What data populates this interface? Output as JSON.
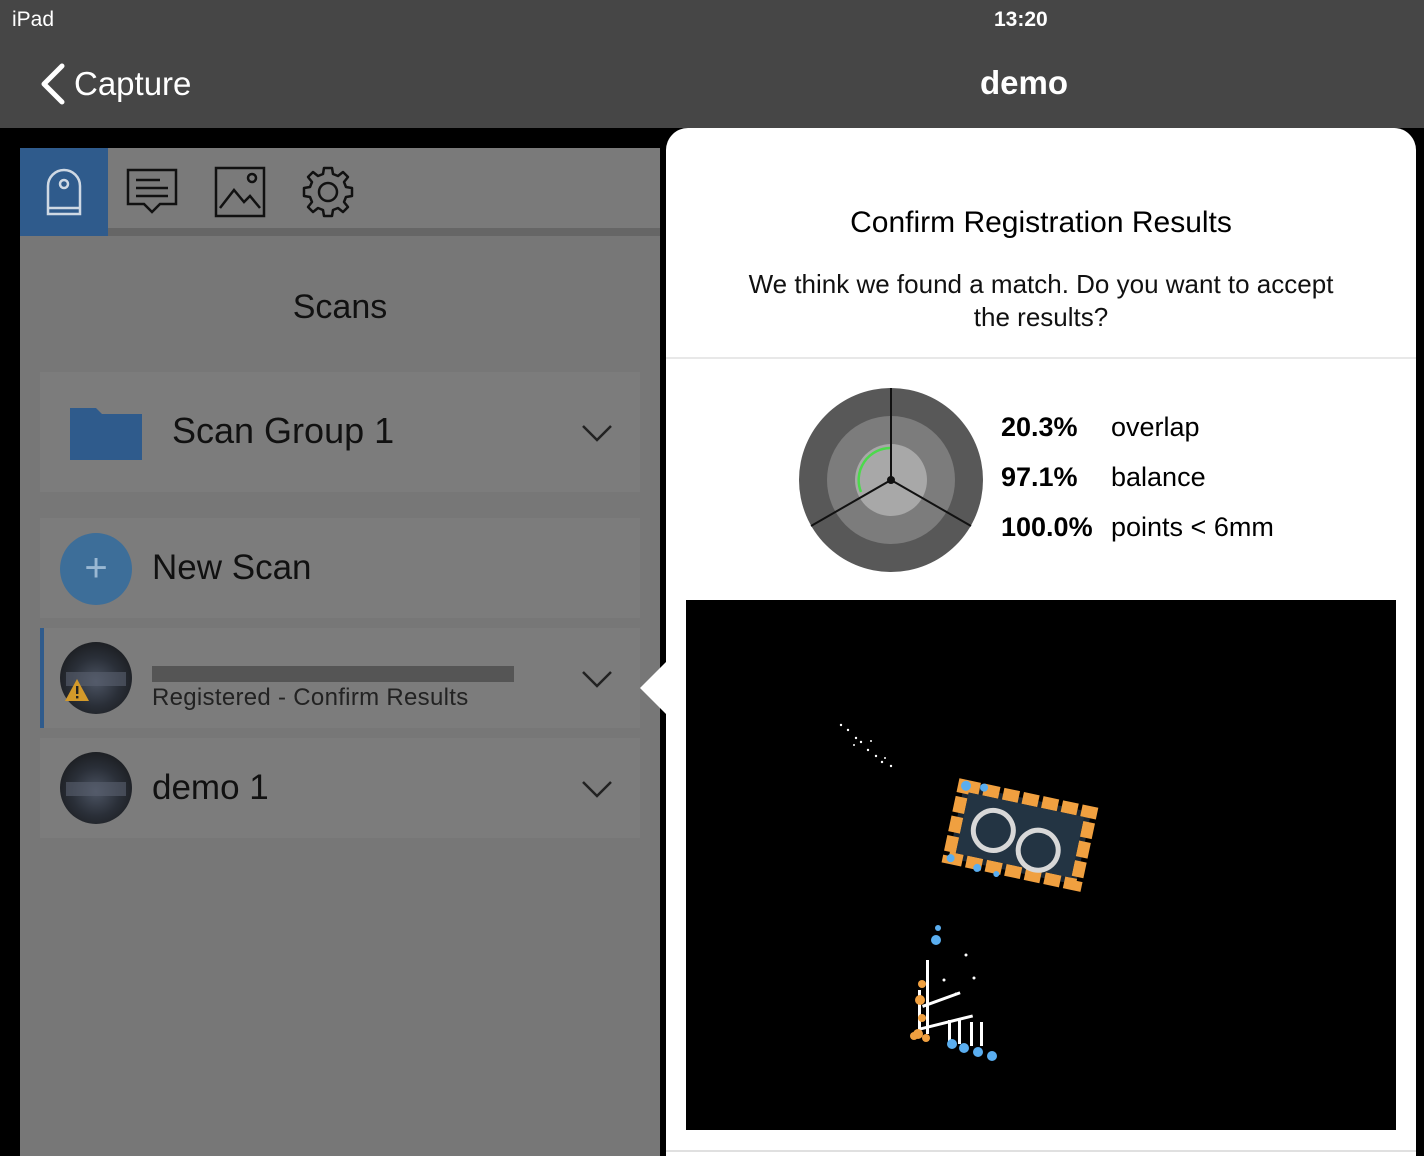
{
  "status_bar": {
    "device": "iPad",
    "time": "13:20"
  },
  "nav": {
    "back_label": "Capture",
    "title": "demo"
  },
  "tabs": [
    {
      "icon": "scanner-icon",
      "active": true
    },
    {
      "icon": "comment-icon",
      "active": false
    },
    {
      "icon": "image-icon",
      "active": false
    },
    {
      "icon": "gear-icon",
      "active": false
    }
  ],
  "panel": {
    "title": "Scans",
    "group": {
      "label": "Scan Group 1",
      "icon": "folder-icon"
    },
    "new_scan": {
      "label": "New Scan",
      "icon": "plus-icon"
    },
    "scans": [
      {
        "name": "",
        "status": "Registered - Confirm Results",
        "warning": true
      },
      {
        "name": "demo 1",
        "status": ""
      }
    ]
  },
  "popover": {
    "title": "Confirm Registration Results",
    "message": "We think we found a match. Do you want to accept the results?",
    "stats": [
      {
        "value": "20.3%",
        "label": "overlap"
      },
      {
        "value": "97.1%",
        "label": "balance"
      },
      {
        "value": "100.0%",
        "label": "points < 6mm"
      }
    ],
    "colors": {
      "accent_blue": "#2f5b8c",
      "cloud_orange": "#f0a040",
      "cloud_blue": "#5aaef0",
      "gauge_green": "#4cd94c"
    }
  }
}
